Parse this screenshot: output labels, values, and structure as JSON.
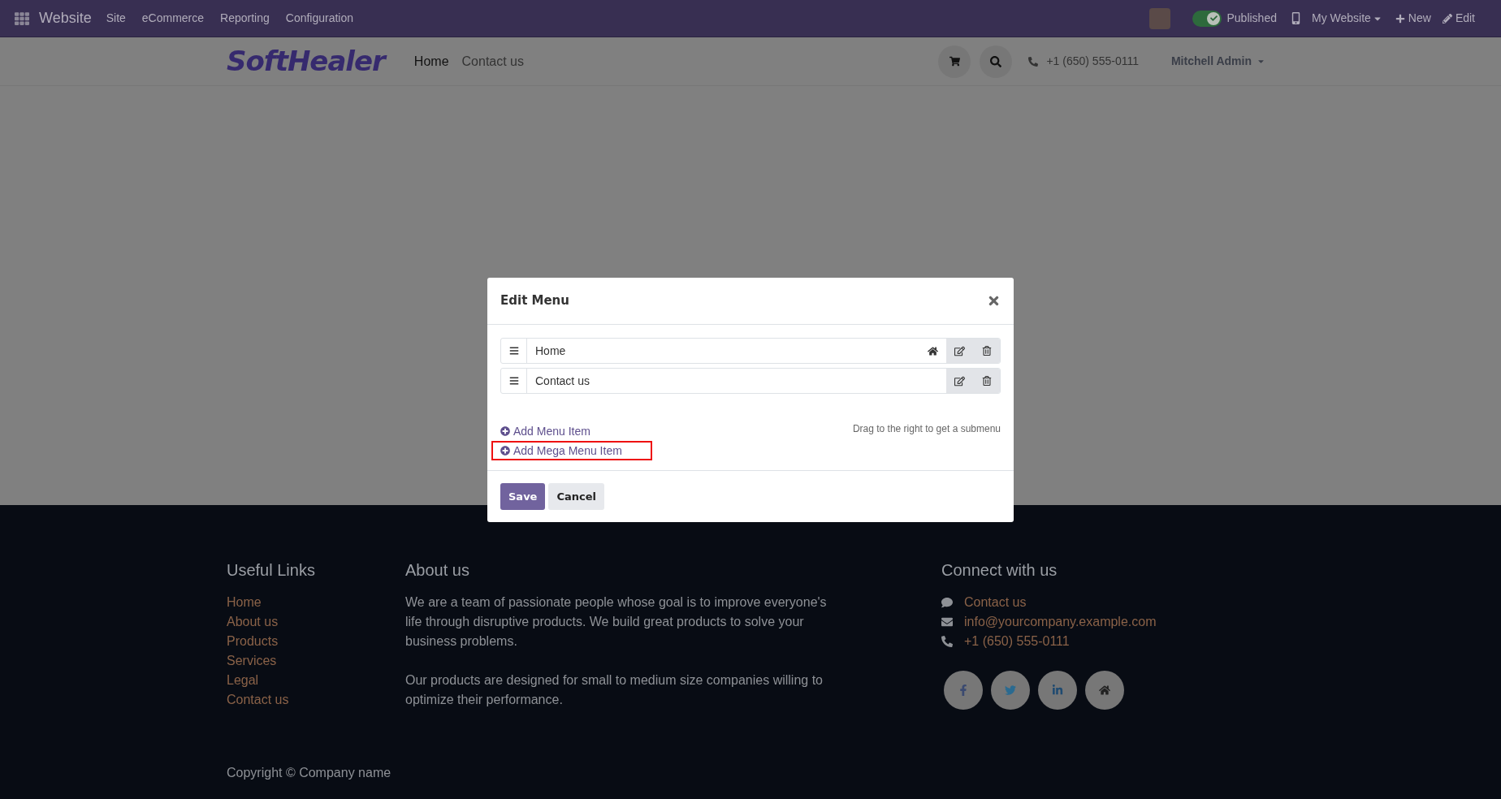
{
  "top_bar": {
    "app_name": "Website",
    "menus": [
      "Site",
      "eCommerce",
      "Reporting",
      "Configuration"
    ],
    "published": {
      "label": "Published",
      "on": true
    },
    "website_switcher": "My Website",
    "actions": [
      {
        "kind": "new",
        "label": "New"
      },
      {
        "kind": "edit",
        "label": "Edit"
      }
    ]
  },
  "header": {
    "logo": "SoftHealer",
    "nav": [
      {
        "label": "Home",
        "selected": true
      },
      {
        "label": "Contact us",
        "selected": false
      }
    ],
    "phone": "+1 (650) 555-0111",
    "user": "Mitchell Admin"
  },
  "dialog": {
    "title": "Edit Menu",
    "items": [
      {
        "label": "Home",
        "home": true
      },
      {
        "label": "Contact us",
        "home": false
      }
    ],
    "add_links": [
      {
        "label": "Add Menu Item",
        "highlighted": false
      },
      {
        "label": "Add Mega Menu Item",
        "highlighted": true
      }
    ],
    "hint": "Drag to the right to get a submenu",
    "buttons": [
      {
        "label": "Save",
        "kind": "primary"
      },
      {
        "label": "Cancel",
        "kind": "secondary"
      }
    ]
  },
  "footer": {
    "links_title": "Useful Links",
    "links": [
      "Home",
      "About us",
      "Products",
      "Services",
      "Legal",
      "Contact us"
    ],
    "about_title": "About us",
    "about_paragraphs": [
      "We are a team of passionate people whose goal is to improve everyone's life through disruptive products. We build great products to solve your business problems.",
      "Our products are designed for small to medium size companies willing to optimize their performance."
    ],
    "connect_title": "Connect with us",
    "contacts": [
      {
        "kind": "chat",
        "label": "Contact us"
      },
      {
        "kind": "email",
        "label": "info@yourcompany.example.com"
      },
      {
        "kind": "phone",
        "label": "+1 (650) 555-0111"
      }
    ],
    "socials": [
      {
        "kind": "facebook"
      },
      {
        "kind": "twitter"
      },
      {
        "kind": "linkedin"
      },
      {
        "kind": "home"
      }
    ],
    "copyright": "Copyright © Company name"
  }
}
